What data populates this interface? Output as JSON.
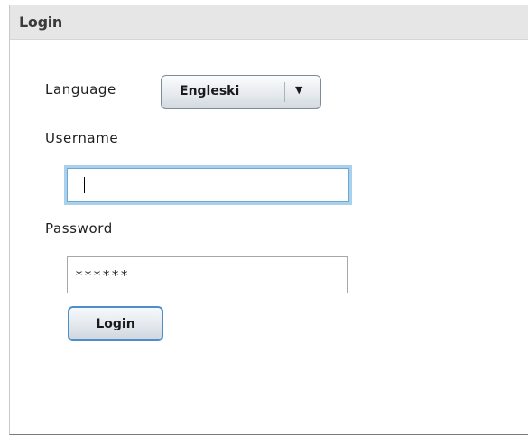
{
  "panel": {
    "title": "Login"
  },
  "language": {
    "label": "Language",
    "selected": "Engleski",
    "arrow_icon": "triangle-down-icon"
  },
  "username": {
    "label": "Username",
    "value": ""
  },
  "password": {
    "label": "Password",
    "value": "******"
  },
  "actions": {
    "login_label": "Login"
  },
  "colors": {
    "header_background": "#e6e6e6",
    "focus_border": "#a9d0ec",
    "button_border": "#4f8fc9"
  }
}
